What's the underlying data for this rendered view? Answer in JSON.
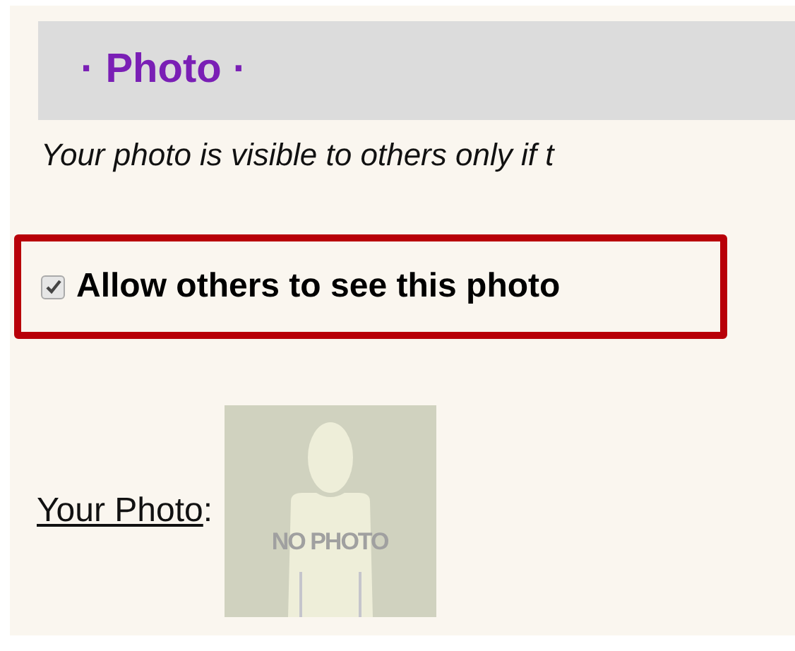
{
  "section": {
    "title": "· Photo ·",
    "note": "Your photo is visible to others only if t"
  },
  "visibility": {
    "label": "Allow others to see this photo",
    "checked": true
  },
  "photo": {
    "label": "Your Photo",
    "separator": ":",
    "placeholder_text": "NO PHOTO"
  }
}
